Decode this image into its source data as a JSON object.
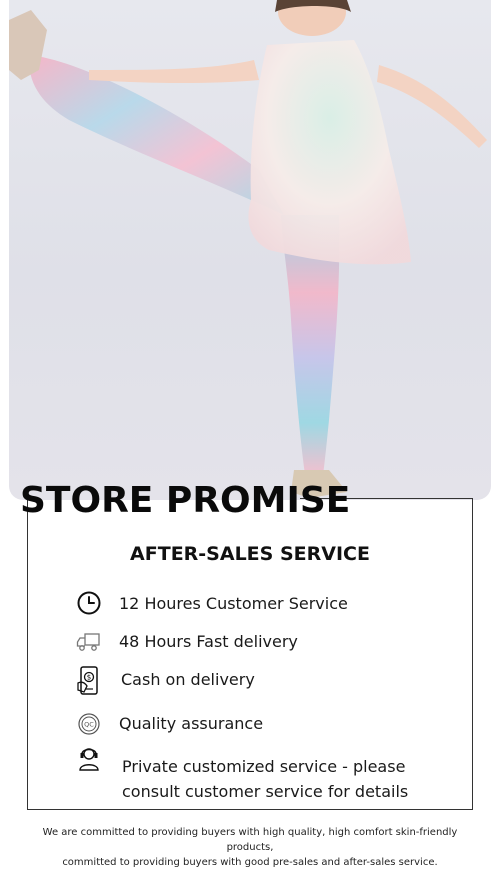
{
  "hero": {
    "colors": {
      "background": "#e2e3ea",
      "legging_pink": "#f2b8c9",
      "legging_blue": "#9fd6e6",
      "top_white": "#f4efe9"
    }
  },
  "promise": {
    "heading": "STORE PROMISE",
    "section_title": "AFTER-SALES SERVICE",
    "items": [
      {
        "icon": "clock-icon",
        "label": "12 Houres Customer Service"
      },
      {
        "icon": "delivery-truck-icon",
        "label": "48 Hours Fast delivery"
      },
      {
        "icon": "cash-phone-icon",
        "label": "Cash on delivery"
      },
      {
        "icon": "quality-badge-icon",
        "label": "Quality assurance"
      },
      {
        "icon": "customer-service-agent-icon",
        "label": "Private customized service - please consult customer service for details"
      }
    ]
  },
  "footer": {
    "line1": "We are committed to providing buyers with high quality, high comfort skin-friendly products,",
    "line2": "committed to providing buyers with good pre-sales and after-sales service."
  }
}
